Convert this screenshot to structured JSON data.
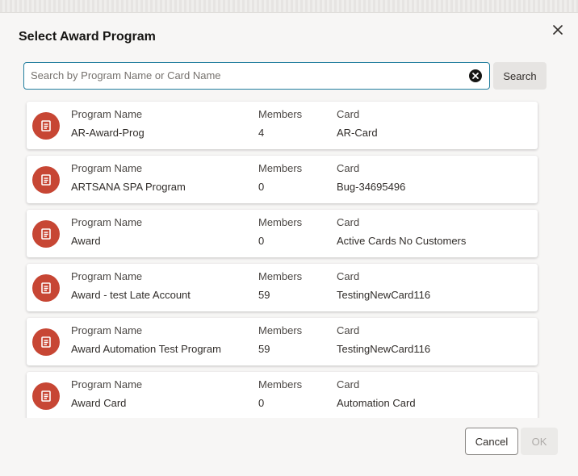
{
  "dialog": {
    "title": "Select Award Program",
    "close_icon": "close-icon"
  },
  "search": {
    "value": "",
    "placeholder": "Search by Program Name or Card Name",
    "button_label": "Search",
    "clear_icon": "clear-circle-icon"
  },
  "columns": {
    "program": "Program Name",
    "members": "Members",
    "card": "Card"
  },
  "programs": [
    {
      "name": "AR-Award-Prog",
      "members": "4",
      "card": "AR-Card"
    },
    {
      "name": "ARTSANA SPA Program",
      "members": "0",
      "card": "Bug-34695496"
    },
    {
      "name": "Award",
      "members": "0",
      "card": "Active Cards No Customers"
    },
    {
      "name": "Award - test Late Account",
      "members": "59",
      "card": "TestingNewCard116"
    },
    {
      "name": "Award Automation Test Program",
      "members": "59",
      "card": "TestingNewCard116"
    },
    {
      "name": "Award Card",
      "members": "0",
      "card": "Automation Card"
    }
  ],
  "footer": {
    "cancel_label": "Cancel",
    "ok_label": "OK"
  },
  "colors": {
    "accent": "#227e9e",
    "avatar": "#c74634"
  }
}
